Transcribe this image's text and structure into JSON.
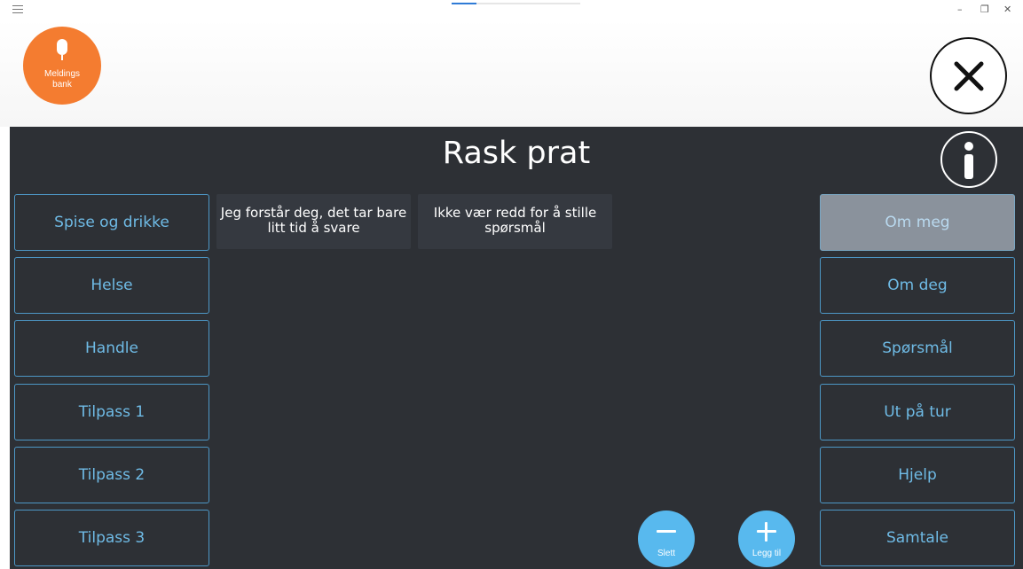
{
  "window": {
    "controls": {
      "minimize": "–",
      "restore": "❐",
      "close": "✕"
    },
    "loading_progress": 0.19
  },
  "header": {
    "message_bank": {
      "label": "Meldings\nbank",
      "icon": "microphone-icon",
      "color": "#f47c30"
    },
    "close_button": {
      "icon": "close-icon"
    }
  },
  "main": {
    "title": "Rask prat",
    "info_button": {
      "icon": "info-icon"
    },
    "left_categories": [
      {
        "label": "Spise og drikke"
      },
      {
        "label": "Helse"
      },
      {
        "label": "Handle"
      },
      {
        "label": "Tilpass 1"
      },
      {
        "label": "Tilpass 2"
      },
      {
        "label": "Tilpass 3"
      }
    ],
    "right_categories": [
      {
        "label": "Om meg",
        "active": true
      },
      {
        "label": "Om deg"
      },
      {
        "label": "Spørsmål"
      },
      {
        "label": "Ut på tur"
      },
      {
        "label": "Hjelp"
      },
      {
        "label": "Samtale"
      }
    ],
    "phrases": [
      {
        "text": "Jeg forstår deg, det tar bare litt tid å svare"
      },
      {
        "text": "Ikke vær redd for å stille spørsmål"
      }
    ],
    "delete_button": {
      "label": "Slett",
      "icon": "minus-icon"
    },
    "add_button": {
      "label": "Legg til",
      "icon": "plus-icon"
    }
  },
  "colors": {
    "background": "#2d3035",
    "accent": "#4d97c6",
    "button_text": "#6fbbe6",
    "round_button": "#58b9ee",
    "active_category": "#8a929c"
  }
}
